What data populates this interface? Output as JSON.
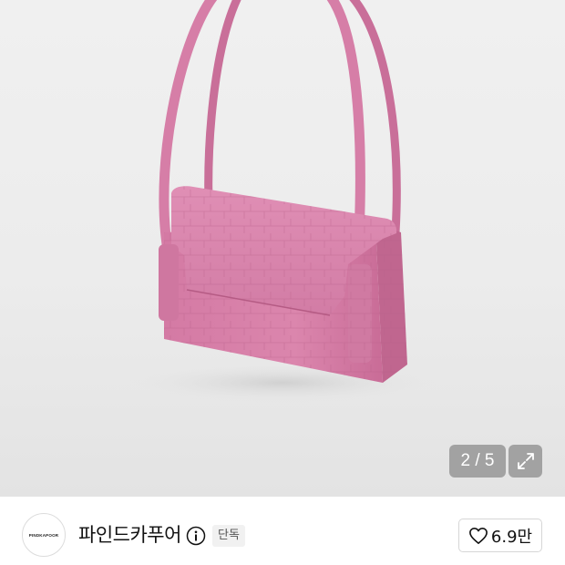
{
  "viewer": {
    "image_alt": "pink croc-embossed shoulder bag",
    "page_indicator": "2 / 5",
    "current_page": 2,
    "total_pages": 5,
    "expand_icon": "expand-icon"
  },
  "store": {
    "logo_text": "PINDKAPOOR",
    "name": "파인드카푸어",
    "info_icon": "info-icon",
    "badge": "단독",
    "likes": "6.9만",
    "heart_icon": "heart-outline-icon"
  },
  "colors": {
    "bag_pink": "#d77fa8",
    "indicator_bg": "#969696"
  }
}
